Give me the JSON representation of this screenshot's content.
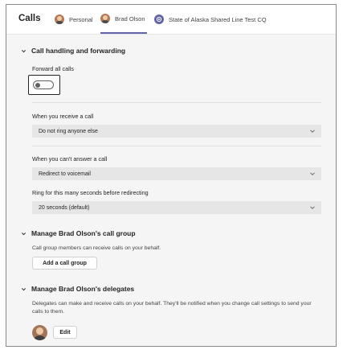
{
  "header": {
    "title": "Calls",
    "tabs": [
      {
        "label": "Personal",
        "avatar": "user-photo",
        "active": false
      },
      {
        "label": "Brad Olson",
        "avatar": "user-photo",
        "active": true
      },
      {
        "label": "State of Alaska Shared Line Test CQ",
        "avatar": "call-queue-icon",
        "active": false
      }
    ],
    "active_tab_color": "#6264a7"
  },
  "call_handling": {
    "title": "Call handling and forwarding",
    "forward_all_label": "Forward all calls",
    "forward_all_on": false,
    "receive_label": "When you receive a call",
    "receive_value": "Do not ring anyone else",
    "unanswered_label": "When you can't answer a call",
    "unanswered_value": "Redirect to voicemail",
    "ring_label": "Ring for this many seconds before redirecting",
    "ring_value": "20 seconds (default)"
  },
  "call_group": {
    "title": "Manage Brad Olson's call group",
    "description": "Call group members can receive calls on your behalf.",
    "button_label": "Add a call group"
  },
  "delegates": {
    "title": "Manage Brad Olson's delegates",
    "description": "Delegates can make and receive calls on your behalf. They'll be notified when you change call settings to send your calls to them.",
    "edit_label": "Edit"
  }
}
